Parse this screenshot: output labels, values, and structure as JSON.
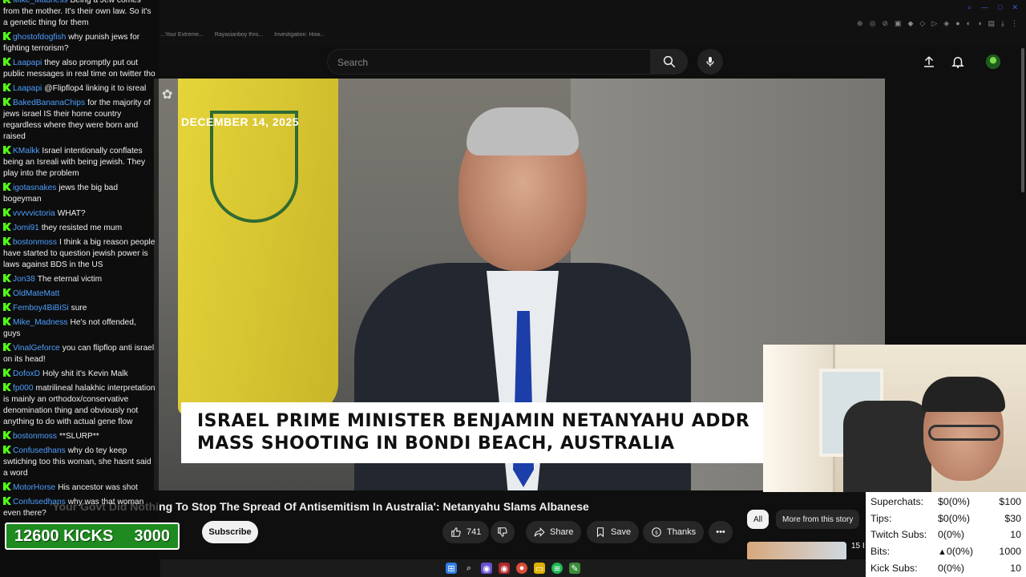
{
  "browser": {
    "tabs": [
      "...Your Extreme...",
      "Rayasianboy thro...",
      "Investigation: How..."
    ]
  },
  "header": {
    "search_placeholder": "Search"
  },
  "video": {
    "date_tag": "DECEMBER 14, 2025",
    "lower_third_line1": "ISRAEL PRIME MINISTER BENJAMIN NETANYAHU ADDRESSES",
    "lower_third_line2": "MASS SHOOTING IN BONDI BEACH, AUSTRALIA",
    "title": "'Your Govt Did Nothing To Stop The Spread Of Antisemitism In Australia': Netanyahu Slams Albanese"
  },
  "actions": {
    "subscribe": "Subscribe",
    "like_count": "741",
    "share": "Share",
    "save": "Save",
    "thanks": "Thanks",
    "more": "•••"
  },
  "chips": {
    "all": "All",
    "more_from_story": "More from this story"
  },
  "side": {
    "partial_text": "15 I"
  },
  "chat": [
    {
      "user": "Mike_Madness",
      "text": "Being a Jew comes from the mother. It's their own law. So it's a genetic thing for them"
    },
    {
      "user": "ghostofdogfish",
      "text": "why punish jews for fighting terrorism?"
    },
    {
      "user": "Laapapi",
      "text": "they also promptly put out public messages in real time on twitter tho"
    },
    {
      "user": "Laapapi",
      "text": "@Flipflop4 linking it to isreal"
    },
    {
      "user": "BakedBananaChips",
      "text": "for the majority of jews israel IS their home country regardless where they were born and raised"
    },
    {
      "user": "KMalkk",
      "text": "Israel intentionally conflates being an Isreali with being jewish. They play into the problem"
    },
    {
      "user": "igotasnakes",
      "text": "jews the big bad bogeyman"
    },
    {
      "user": "vvvvvictoria",
      "text": "WHAT?"
    },
    {
      "user": "Jomi91",
      "text": "they resisted me mum"
    },
    {
      "user": "bostonmoss",
      "text": "I think a big reason people have started to question jewish power is laws against BDS in the US"
    },
    {
      "user": "Jon38",
      "text": "The eternal victim"
    },
    {
      "user": "OldMateMatt",
      "text": ""
    },
    {
      "user": "Femboy4BiBiSi",
      "text": "sure"
    },
    {
      "user": "Mike_Madness",
      "text": "He's not offended, guys"
    },
    {
      "user": "VinalGeforce",
      "text": "you can flipflop anti israel on its head!"
    },
    {
      "user": "DofoxD",
      "text": "Holy shit it's Kevin Malk"
    },
    {
      "user": "fp000",
      "text": "matrilineal halakhic interpretation is mainly an orthodox/conservative denomination thing and obviously not anything to do with actual gene flow"
    },
    {
      "user": "bostonmoss",
      "text": "**SLURP**"
    },
    {
      "user": "Confusedhans",
      "text": "why do tey keep swtiching too this woman, she hasnt said a word"
    },
    {
      "user": "MotorHorse",
      "text": "His ancestor was shot"
    },
    {
      "user": "Confusedhans",
      "text": "why was that woman even there?"
    }
  ],
  "kicks": {
    "label": "12600 KICKS",
    "goal": "3000"
  },
  "stats": [
    {
      "label": "Superchats:",
      "value": "$0(0%)",
      "goal": "$100"
    },
    {
      "label": "Tips:",
      "value": "$0(0%)",
      "goal": "$30"
    },
    {
      "label": "Twitch Subs:",
      "value": "0(0%)",
      "goal": "10"
    },
    {
      "label": "Bits:",
      "value": "0(0%)",
      "goal": "1000"
    },
    {
      "label": "Kick Subs:",
      "value": "0(0%)",
      "goal": "10"
    }
  ],
  "colors": {
    "kick_green": "#53fc18",
    "chat_user": "#4d9fff",
    "yt_bg": "#0f0f0f"
  }
}
